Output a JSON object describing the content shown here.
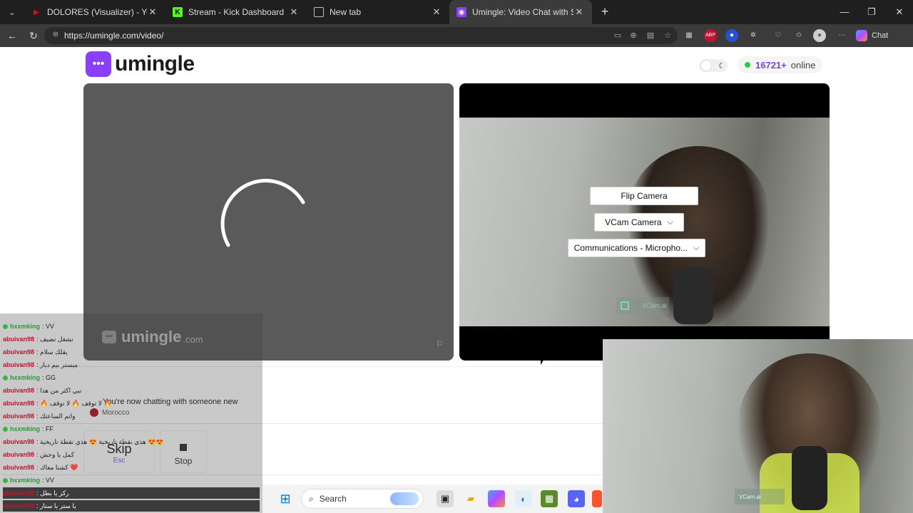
{
  "tabs": [
    {
      "title": "DOLORES (Visualizer) - YouTube",
      "close": "✕",
      "icon": "youtube-icon",
      "color": "#ff0000"
    },
    {
      "title": "Stream - Kick Dashboard",
      "close": "✕",
      "icon": "kick-icon",
      "color": "#53fc18"
    },
    {
      "title": "New tab",
      "close": "✕",
      "icon": "newtab-icon",
      "color": "#bbbbbb"
    },
    {
      "title": "Umingle: Video Chat with Stra",
      "close": "✕",
      "icon": "umingle-icon",
      "color": "#8a3ffc"
    }
  ],
  "browser": {
    "url": "https://umingle.com/video/",
    "chat_label": "Chat",
    "new_tab": "+",
    "window": {
      "minimize": "—",
      "maximize": "❐",
      "close": "✕"
    }
  },
  "site": {
    "logo_text": "umingle",
    "online_count": "16721+",
    "online_label": "online"
  },
  "left_panel": {
    "watermark_name": "umingle",
    "watermark_suffix": ".com"
  },
  "right_panel": {
    "flip_camera": "Flip Camera",
    "camera_select": "VCam Camera",
    "mic_select": "Communications - Micropho...",
    "vcam_watermark": "VCam.ai"
  },
  "chat_area": {
    "system_message": "You're now chatting with someone new",
    "country": "Morocco",
    "skip_label": "Skip",
    "skip_key": "Esc",
    "stop_label": "Stop"
  },
  "overlay_chat": [
    {
      "user": "hxxmking",
      "msg": ": VV",
      "style": "grn"
    },
    {
      "user": "abuivan98",
      "msg": ": تشغل نضيف",
      "style": "red"
    },
    {
      "user": "abuivan98",
      "msg": ": يقلك سلام",
      "style": "red"
    },
    {
      "user": "abuivan98",
      "msg": ": ميستر بيم ديار",
      "style": "red"
    },
    {
      "user": "hxxmking",
      "msg": ": GG",
      "style": "grn"
    },
    {
      "user": "abuivan98",
      "msg": ": نبي اكثر من هذا",
      "style": "red"
    },
    {
      "user": "abuivan98",
      "msg": ": 🔥 لا توقف 🔥 لا توقف 🔥",
      "style": "red"
    },
    {
      "user": "abuivan98",
      "msg": ": واتم الساعتك",
      "style": "red"
    },
    {
      "user": "hxxmking",
      "msg": ": FF",
      "style": "grn"
    },
    {
      "user": "abuivan98",
      "msg": ": هذي نقطة تاريخية 😍 هذي نقطة تاريخية 😍😍",
      "style": "red"
    },
    {
      "user": "abuivan98",
      "msg": ": كمل يا وحش",
      "style": "red"
    },
    {
      "user": "abuivan98",
      "msg": ": كشنا معاك ❤️",
      "style": "red"
    },
    {
      "user": "hxxmking",
      "msg": ": VV",
      "style": "grn"
    },
    {
      "user": "abuivan98",
      "msg": ": ركز يا بطل",
      "style": "red"
    },
    {
      "user": "abuivan98",
      "msg": ": يا ستر يا ستار",
      "style": "red"
    }
  ],
  "webcam_overlay": {
    "vcam_watermark": "VCam.ai"
  },
  "taskbar": {
    "search_label": "Search"
  },
  "colors": {
    "brand": "#8a3ffc",
    "online_dot": "#2ecc40"
  }
}
